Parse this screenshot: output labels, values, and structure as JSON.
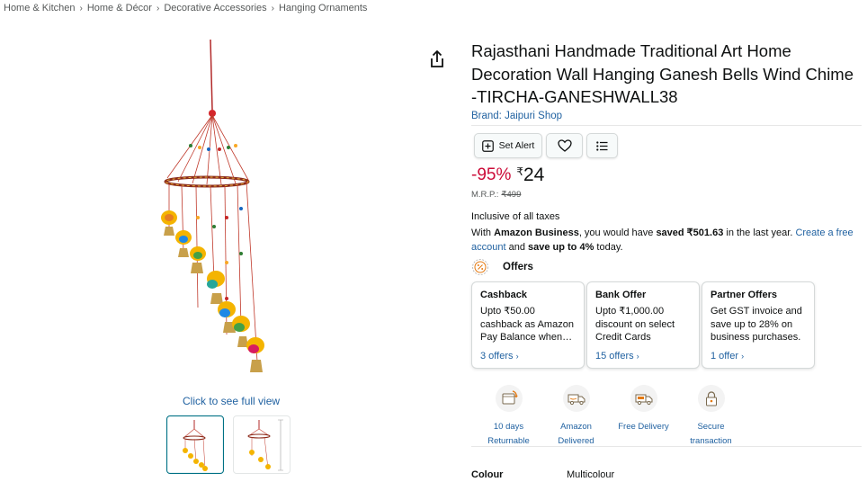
{
  "breadcrumb": {
    "items": [
      "Home & Kitchen",
      "Home & Décor",
      "Decorative Accessories",
      "Hanging Ornaments"
    ],
    "separator": "›"
  },
  "gallery": {
    "view_full_label": "Click to see full view",
    "main_image_icon": "ganesh-bells-wind-chime-image",
    "thumbnails": [
      "ganesh-wind-chime-thumbnail",
      "ganesh-wind-chime-dimensions-thumbnail"
    ],
    "selected_thumbnail": 0
  },
  "product": {
    "title": "Rajasthani Handmade Traditional Art Home Decoration Wall Hanging Ganesh Bells Wind Chime -TIRCHA-GANESHWALL38",
    "brand": "Brand: Jaipuri Shop"
  },
  "actions": {
    "set_alert_label": "Set Alert",
    "set_alert_icon": "plus-square-icon",
    "wishlist_icon": "heart-icon",
    "list_icon": "list-icon"
  },
  "pricing": {
    "discount": "-95%",
    "currency": "₹",
    "price": "24",
    "mrp_label": "M.R.P.:",
    "mrp_value": "₹499",
    "inclusive": "Inclusive of all taxes"
  },
  "business": {
    "part1": "With ",
    "amazon_business": "Amazon Business",
    "part2": ", you would have ",
    "saved": "saved ₹501.63",
    "part3": " in the last year. ",
    "link": "Create a free account",
    "part4": " and ",
    "save_up": "save up to 4%",
    "part5": " today."
  },
  "offers": {
    "title": "Offers",
    "icon": "percent-badge-icon",
    "cards": [
      {
        "title": "Cashback",
        "desc": "Upto ₹50.00 cashback as Amazon Pay Balance when…",
        "link": "3 offers"
      },
      {
        "title": "Bank Offer",
        "desc": "Upto ₹1,000.00 discount on select Credit Cards",
        "link": "15 offers"
      },
      {
        "title": "Partner Offers",
        "desc": "Get GST invoice and save up to 28% on business purchases.",
        "link": "1 offer"
      }
    ]
  },
  "features": [
    {
      "label": "10 days Returnable",
      "icon": "return-box-icon"
    },
    {
      "label": "Amazon Delivered",
      "icon": "delivery-truck-icon"
    },
    {
      "label": "Free Delivery",
      "icon": "free-delivery-truck-icon"
    },
    {
      "label": "Secure transaction",
      "icon": "padlock-icon"
    }
  ],
  "specs": [
    {
      "key": "Colour",
      "value": "Multicolour"
    }
  ],
  "colors": {
    "link": "#2162a1",
    "discount": "#cc0c39",
    "text": "#0f1111",
    "muted": "#565959"
  }
}
